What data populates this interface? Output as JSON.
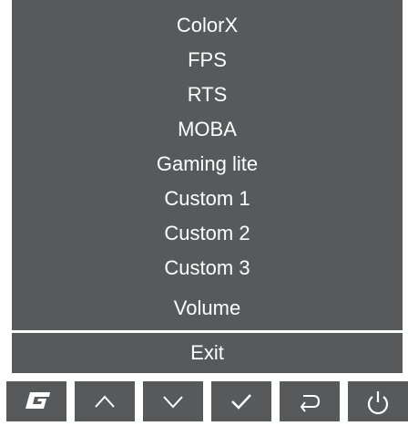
{
  "menu": {
    "items": [
      {
        "label": "ColorX"
      },
      {
        "label": "FPS"
      },
      {
        "label": "RTS"
      },
      {
        "label": "MOBA"
      },
      {
        "label": "Gaming lite"
      },
      {
        "label": "Custom 1"
      },
      {
        "label": "Custom 2"
      },
      {
        "label": "Custom 3"
      }
    ],
    "volume_label": "Volume",
    "exit_label": "Exit"
  },
  "buttons": [
    {
      "icon": "gaming-logo-icon"
    },
    {
      "icon": "arrow-up-icon"
    },
    {
      "icon": "arrow-down-icon"
    },
    {
      "icon": "checkmark-icon"
    },
    {
      "icon": "back-icon"
    },
    {
      "icon": "power-icon"
    }
  ],
  "colors": {
    "panel": "#58595b",
    "text": "#ffffff",
    "background": "#ffffff"
  }
}
